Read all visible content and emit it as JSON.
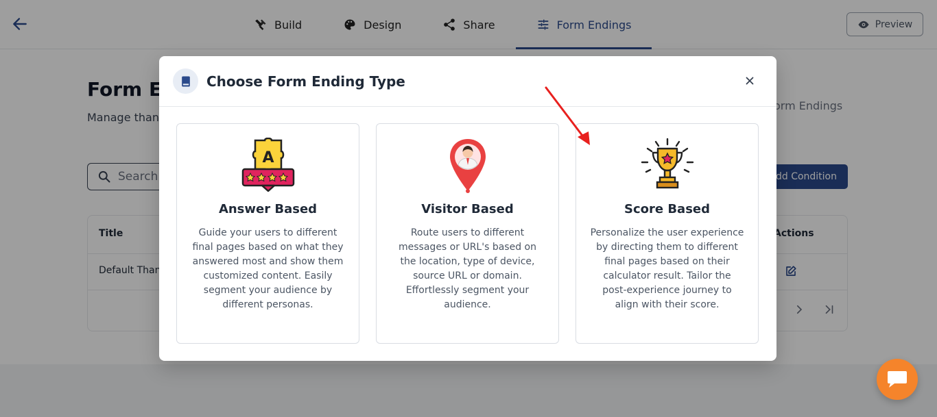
{
  "topbar": {
    "tabs": [
      {
        "label": "Build",
        "icon": "build-tools-icon"
      },
      {
        "label": "Design",
        "icon": "palette-icon"
      },
      {
        "label": "Share",
        "icon": "share-icon"
      },
      {
        "label": "Form Endings",
        "icon": "form-endings-icon",
        "active": true
      }
    ],
    "preview_label": "Preview"
  },
  "background": {
    "page_title": "Form E",
    "page_subtitle": "Manage than",
    "breadcrumb_right": "orm Endings",
    "search_placeholder": "Search e",
    "add_condition_label": "dd Condition",
    "table": {
      "columns": [
        "Title",
        "Actions"
      ],
      "rows": [
        {
          "title": "Default Than"
        }
      ]
    }
  },
  "modal": {
    "title": "Choose Form Ending Type",
    "cards": [
      {
        "title": "Answer Based",
        "description": "Guide your users to different final pages based on what they answered most and show them customized content. Easily segment your audience by different personas.",
        "icon": "puzzle-rating-icon"
      },
      {
        "title": "Visitor Based",
        "description": "Route users to different messages or URL's based on the location, type of device, source URL or domain. Effortlessly segment your audience.",
        "icon": "location-pin-user-icon"
      },
      {
        "title": "Score Based",
        "description": "Personalize the user experience by directing them to different final pages based on their calculator result. Tailor the post-experience journey to align with their score.",
        "icon": "trophy-icon"
      }
    ]
  },
  "colors": {
    "primary": "#2b4a8b",
    "chat_orange": "#f5842b",
    "arrow_red": "#e8201e"
  }
}
